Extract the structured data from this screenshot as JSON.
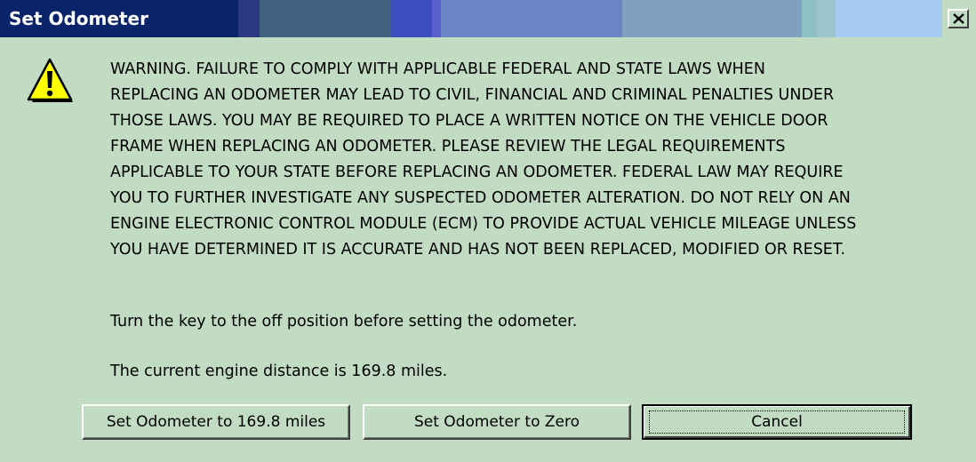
{
  "window": {
    "title": "Set Odometer",
    "close_icon": "close-icon"
  },
  "icon": "warning-icon",
  "warning_text": "WARNING.  FAILURE TO COMPLY WITH APPLICABLE FEDERAL AND STATE LAWS WHEN\nREPLACING AN ODOMETER MAY LEAD TO CIVIL, FINANCIAL AND CRIMINAL PENALTIES UNDER\nTHOSE LAWS.  YOU MAY BE REQUIRED TO PLACE A WRITTEN NOTICE ON THE VEHICLE DOOR\nFRAME WHEN REPLACING AN ODOMETER.  PLEASE REVIEW THE LEGAL REQUIREMENTS\nAPPLICABLE TO YOUR STATE BEFORE REPLACING AN ODOMETER.  FEDERAL LAW MAY REQUIRE\nYOU TO FURTHER INVESTIGATE ANY SUSPECTED ODOMETER ALTERATION.  DO NOT RELY ON AN\nENGINE ELECTRONIC CONTROL MODULE (ECM) TO PROVIDE ACTUAL VEHICLE MILEAGE UNLESS\nYOU HAVE DETERMINED IT IS ACCURATE AND HAS NOT BEEN REPLACED, MODIFIED OR RESET.",
  "instruction": "Turn the key to the off position before setting the odometer.",
  "distance_text": "The current engine distance is 169.8 miles.",
  "buttons": {
    "set_current": "Set Odometer to 169.8 miles",
    "set_zero": "Set Odometer to Zero",
    "cancel": "Cancel"
  },
  "colors": {
    "dialog_background": "#c2dcc4",
    "title_bar_start": "#0a246a",
    "title_bar_end": "#a6caf0",
    "warning_yellow": "#ffff00"
  }
}
